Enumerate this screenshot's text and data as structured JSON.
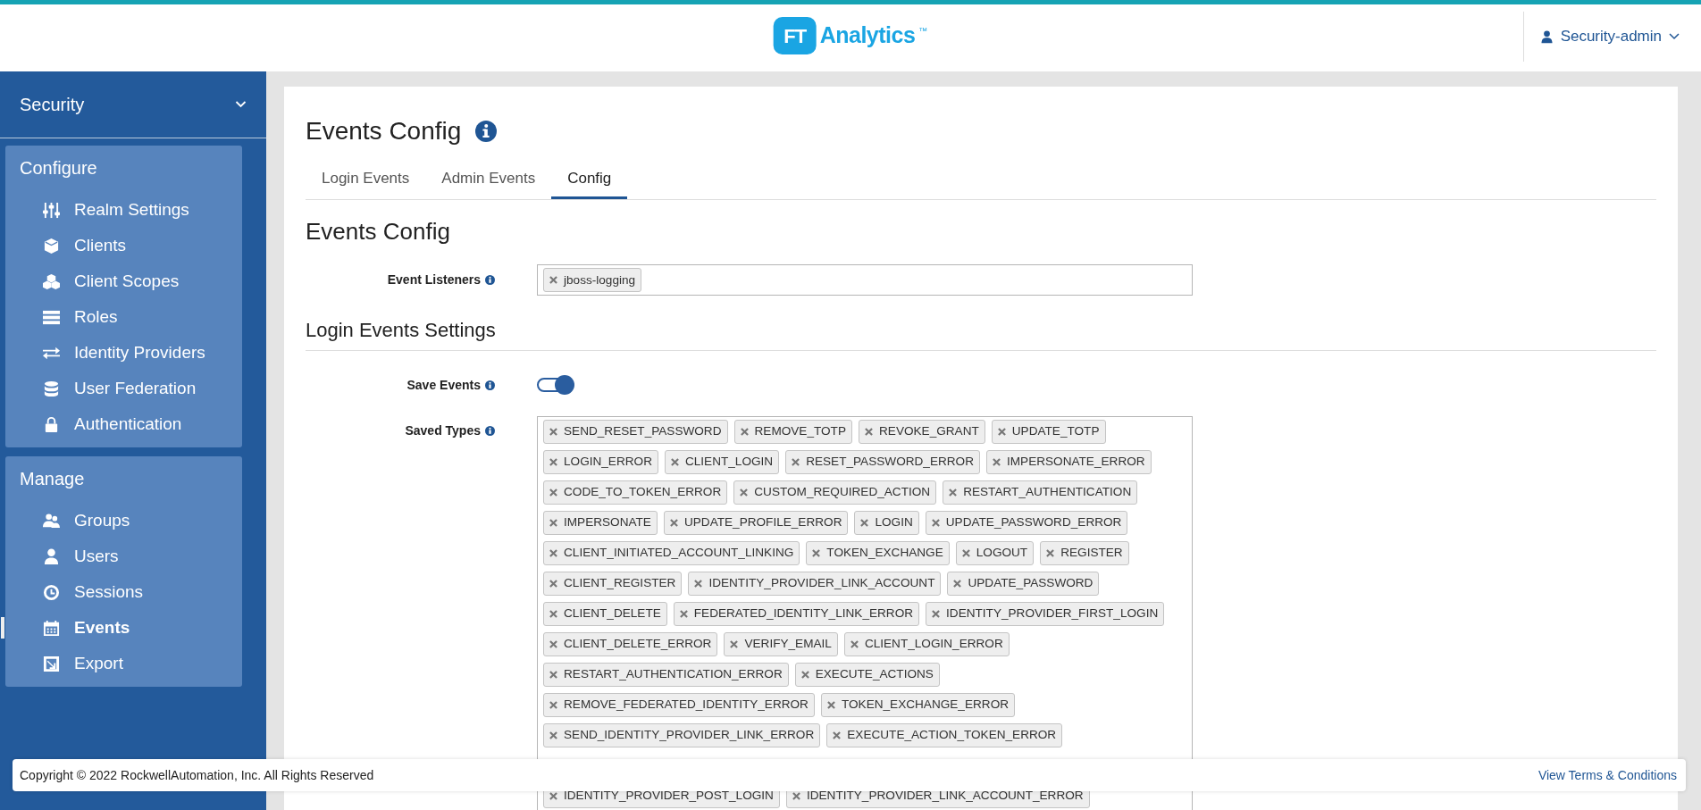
{
  "logo": {
    "mark": "FT",
    "name": "Analytics",
    "trademark": "™"
  },
  "user_menu": {
    "label": "Security-admin"
  },
  "sidebar": {
    "realm": "Security",
    "sections": [
      {
        "title": "Configure",
        "items": [
          {
            "label": "Realm Settings",
            "selected": false
          },
          {
            "label": "Clients",
            "selected": false
          },
          {
            "label": "Client Scopes",
            "selected": false
          },
          {
            "label": "Roles",
            "selected": false
          },
          {
            "label": "Identity Providers",
            "selected": false
          },
          {
            "label": "User Federation",
            "selected": false
          },
          {
            "label": "Authentication",
            "selected": false
          }
        ]
      },
      {
        "title": "Manage",
        "items": [
          {
            "label": "Groups",
            "selected": false
          },
          {
            "label": "Users",
            "selected": false
          },
          {
            "label": "Sessions",
            "selected": false
          },
          {
            "label": "Events",
            "selected": true
          },
          {
            "label": "Export",
            "selected": false
          }
        ]
      }
    ]
  },
  "page_title": "Events Config",
  "tabs": [
    {
      "label": "Login Events",
      "selected": false
    },
    {
      "label": "Admin Events",
      "selected": false
    },
    {
      "label": "Config",
      "selected": true
    }
  ],
  "section_title": "Events Config",
  "event_listeners": {
    "label": "Event Listeners",
    "tags": [
      "jboss-logging"
    ]
  },
  "login_settings_title": "Login Events Settings",
  "save_events": {
    "label": "Save Events",
    "on": true
  },
  "saved_types": {
    "label": "Saved Types",
    "tags": [
      "SEND_RESET_PASSWORD",
      "REMOVE_TOTP",
      "REVOKE_GRANT",
      "UPDATE_TOTP",
      "LOGIN_ERROR",
      "CLIENT_LOGIN",
      "RESET_PASSWORD_ERROR",
      "IMPERSONATE_ERROR",
      "CODE_TO_TOKEN_ERROR",
      "CUSTOM_REQUIRED_ACTION",
      "RESTART_AUTHENTICATION",
      "IMPERSONATE",
      "UPDATE_PROFILE_ERROR",
      "LOGIN",
      "UPDATE_PASSWORD_ERROR",
      "CLIENT_INITIATED_ACCOUNT_LINKING",
      "TOKEN_EXCHANGE",
      "LOGOUT",
      "REGISTER",
      "CLIENT_REGISTER",
      "IDENTITY_PROVIDER_LINK_ACCOUNT",
      "UPDATE_PASSWORD",
      "CLIENT_DELETE",
      "FEDERATED_IDENTITY_LINK_ERROR",
      "IDENTITY_PROVIDER_FIRST_LOGIN",
      "CLIENT_DELETE_ERROR",
      "VERIFY_EMAIL",
      "CLIENT_LOGIN_ERROR",
      "RESTART_AUTHENTICATION_ERROR",
      "EXECUTE_ACTIONS",
      "REMOVE_FEDERATED_IDENTITY_ERROR",
      "TOKEN_EXCHANGE_ERROR",
      "SEND_IDENTITY_PROVIDER_LINK_ERROR",
      "EXECUTE_ACTION_TOKEN_ERROR"
    ],
    "tags_below_footer": [
      "IDENTITY_PROVIDER_POST_LOGIN",
      "IDENTITY_PROVIDER_LINK_ACCOUNT_ERROR"
    ]
  },
  "footer": {
    "copyright": "Copyright © 2022 RockwellAutomation, Inc. All Rights Reserved",
    "terms_link": "View Terms & Conditions"
  }
}
